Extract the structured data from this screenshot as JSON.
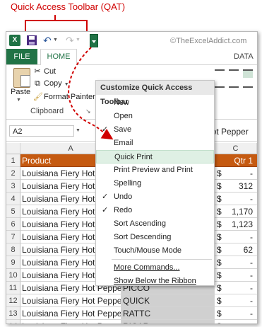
{
  "annotation": {
    "callout_text": "Quick Access Toolbar (QAT)"
  },
  "qat": {
    "excel_icon": "X",
    "watermark": "©TheExcelAddict.com"
  },
  "ribbon": {
    "tabs": {
      "file": "FILE",
      "home": "HOME",
      "data_partial": "DATA"
    },
    "paste_label": "Paste",
    "cut_label": "Cut",
    "copy_label": "Copy",
    "format_painter_label": "Format Painter",
    "clipboard_group_label": "Clipboard",
    "clipboard_launcher": "↘"
  },
  "formula_bar": {
    "name_box": "A2",
    "content_partial": "Hot Pepper"
  },
  "grid": {
    "columns": [
      "A",
      "B",
      "C"
    ],
    "rows": [
      {
        "num": "1",
        "a": "Product",
        "b": "",
        "c_cur": "",
        "c_num": "Qtr 1",
        "header": true
      },
      {
        "num": "2",
        "a": "Louisiana Fiery Hot Pepper Sauce",
        "b": "",
        "c_cur": "$",
        "c_num": "-"
      },
      {
        "num": "3",
        "a": "Louisiana Fiery Hot Pepper Sauce",
        "b": "",
        "c_cur": "$",
        "c_num": "312"
      },
      {
        "num": "4",
        "a": "Louisiana Fiery Hot Pepper Sauce",
        "b": "",
        "c_cur": "$",
        "c_num": "-"
      },
      {
        "num": "5",
        "a": "Louisiana Fiery Hot Pepper Sauce",
        "b": "",
        "c_cur": "$",
        "c_num": "1,170"
      },
      {
        "num": "6",
        "a": "Louisiana Fiery Hot Pepper Sauce",
        "b": "",
        "c_cur": "$",
        "c_num": "1,123"
      },
      {
        "num": "7",
        "a": "Louisiana Fiery Hot Pepper Sauce",
        "b": "",
        "c_cur": "$",
        "c_num": "-"
      },
      {
        "num": "8",
        "a": "Louisiana Fiery Hot Pepper Sauce",
        "b": "",
        "c_cur": "$",
        "c_num": "62"
      },
      {
        "num": "9",
        "a": "Louisiana Fiery Hot Pepper Sauce",
        "b": "",
        "c_cur": "$",
        "c_num": "-"
      },
      {
        "num": "10",
        "a": "Louisiana Fiery Hot Pepper Sauce",
        "b": "OTTIK",
        "c_cur": "$",
        "c_num": "-"
      },
      {
        "num": "11",
        "a": "Louisiana Fiery Hot Pepper Sauce",
        "b": "PICCO",
        "c_cur": "$",
        "c_num": "-"
      },
      {
        "num": "12",
        "a": "Louisiana Fiery Hot Pepper Sauce",
        "b": "QUICK",
        "c_cur": "$",
        "c_num": "-"
      },
      {
        "num": "13",
        "a": "Louisiana Fiery Hot Pepper Sauce",
        "b": "RATTC",
        "c_cur": "$",
        "c_num": "-"
      },
      {
        "num": "14",
        "a": "Louisiana Fiery Hot Pepper Sauce",
        "b": "RICAR",
        "c_cur": "$",
        "c_num": "-"
      }
    ]
  },
  "menu": {
    "title": "Customize Quick Access Toolbar",
    "items": [
      {
        "label": "New",
        "checked": false
      },
      {
        "label": "Open",
        "checked": false
      },
      {
        "label": "Save",
        "checked": true
      },
      {
        "label": "Email",
        "checked": false
      },
      {
        "label": "Quick Print",
        "checked": false,
        "highlighted": true
      },
      {
        "label": "Print Preview and Print",
        "checked": false
      },
      {
        "label": "Spelling",
        "checked": false
      },
      {
        "label": "Undo",
        "checked": true
      },
      {
        "label": "Redo",
        "checked": true
      },
      {
        "label": "Sort Ascending",
        "checked": false
      },
      {
        "label": "Sort Descending",
        "checked": false
      },
      {
        "label": "Touch/Mouse Mode",
        "checked": false
      }
    ],
    "more_commands": "More Commands...",
    "show_below": "Show Below the Ribbon",
    "check_glyph": "✓"
  },
  "colors": {
    "accent": "#217346",
    "annotation": "#d00000",
    "header_fill": "#c55a11",
    "highlight": "#dff0e4"
  }
}
